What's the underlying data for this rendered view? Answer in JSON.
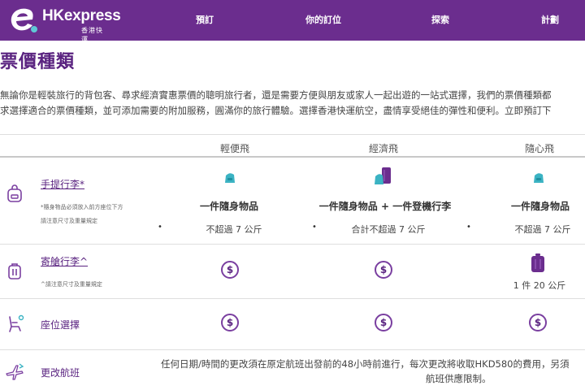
{
  "brand": {
    "name_prefix": "HK",
    "name_suffix": "express",
    "sub": "香港快運",
    "color": "#6b2d8e"
  },
  "nav": [
    "預訂",
    "你的訂位",
    "探索",
    "計劃"
  ],
  "page": {
    "title": "票價種類",
    "intro_line1": "無論你是輕裝旅行的背包客、尋求經濟實惠票價的聰明旅行者，還是需要方便與朋友或家人一起出遊的一站式選擇，我們的票價種類都",
    "intro_line2": "求選擇適合的票價種類，並可添加需要的附加服務，圓滿你的旅行體驗。選擇香港快運航空，盡情享受絕佳的彈性和便利。立即預訂下"
  },
  "fares": [
    "輕便飛",
    "經濟飛",
    "隨心飛"
  ],
  "rows": {
    "carry_on": {
      "label": "手提行李*",
      "note1": "*隨身物品必須放入前方座位下方",
      "note2": "請注意尺寸及重量規定",
      "cells": [
        {
          "title": "一件隨身物品",
          "sub": "不超過 7 公斤"
        },
        {
          "title": "一件隨身物品 + 一件登機行李",
          "sub": "合計不超過 7 公斤"
        },
        {
          "title": "一件隨身物品",
          "sub": "不超過 7 公斤"
        }
      ]
    },
    "checked": {
      "label": "寄艙行李^",
      "note1": "^請注意尺寸及重量規定",
      "dollar": "$",
      "flex_value": "1 件 20 公斤"
    },
    "seat": {
      "label": "座位選擇",
      "dollar": "$"
    },
    "change": {
      "label": "更改航班",
      "text1": "任何日期/時間的更改須在原定航班出發前的48小時前進行，每次更改將收取HKD580的費用，另須",
      "text2": "航班供應限制。"
    }
  },
  "bullet": "•",
  "colors": {
    "purple": "#6b2d8e",
    "accent_dark": "#5a2380",
    "teal": "#3bb3c3"
  }
}
